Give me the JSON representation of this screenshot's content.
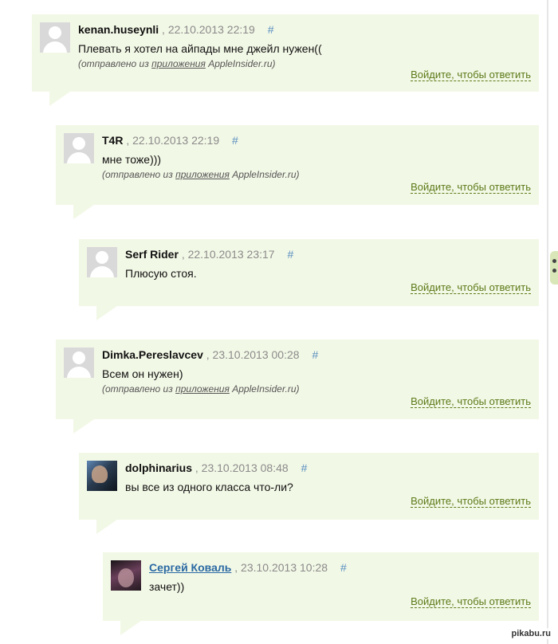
{
  "via": {
    "prefix": "(отправлено из",
    "link": "приложения",
    "suffix": "AppleInsider.ru)"
  },
  "reply_label": "Войдите, чтобы ответить",
  "comments": [
    {
      "author": "kenan.huseynli",
      "date": "22.10.2013 22:19",
      "anchor": "#",
      "text": "Плевать я хотел на айпады мне джейл нужен((",
      "via": true
    },
    {
      "author": "T4R",
      "date": "22.10.2013 22:19",
      "anchor": "#",
      "text": "мне тоже)))",
      "via": true
    },
    {
      "author": "Serf Rider",
      "date": "22.10.2013 23:17",
      "anchor": "#",
      "text": "Плюсую стоя.",
      "via": false
    },
    {
      "author": "Dimka.Pereslavcev",
      "date": "23.10.2013 00:28",
      "anchor": "#",
      "text": "Всем он нужен)",
      "via": true
    },
    {
      "author": "dolphinarius",
      "date": "23.10.2013 08:48",
      "anchor": "#",
      "text": "вы все из одного класса что-ли?",
      "via": false
    },
    {
      "author": "Сергей Коваль",
      "date": "23.10.2013 10:28",
      "anchor": "#",
      "text": "зачет))",
      "via": false
    }
  ],
  "watermark": "pikabu.ru",
  "colors": {
    "bubble_bg": "#f2f8e6",
    "reply_link": "#5c7a18",
    "author_link": "#2b6aa3",
    "anchor": "#5a8fc0"
  }
}
